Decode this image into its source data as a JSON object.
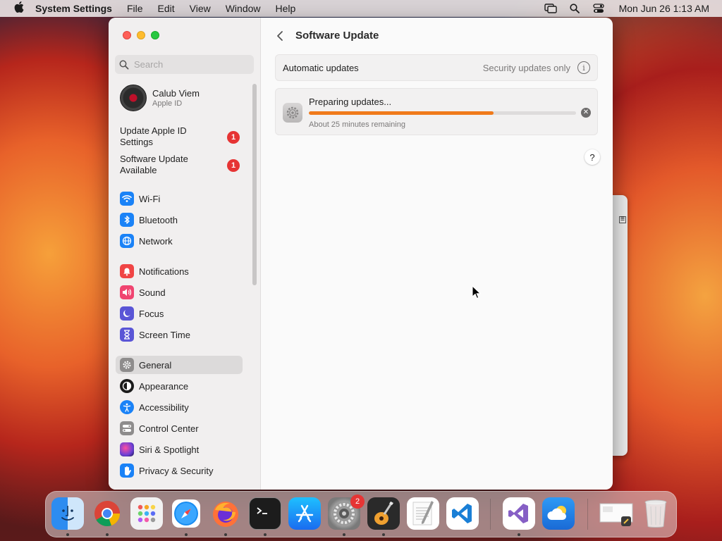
{
  "menubar": {
    "app_name": "System Settings",
    "menus": [
      "File",
      "Edit",
      "View",
      "Window",
      "Help"
    ],
    "clock": "Mon Jun 26  1:13 AM"
  },
  "sidebar": {
    "search_placeholder": "Search",
    "account": {
      "name": "Calub Viem",
      "subtitle": "Apple ID"
    },
    "notices": [
      {
        "label": "Update Apple ID Settings",
        "badge": "1"
      },
      {
        "label": "Software Update Available",
        "badge": "1"
      }
    ],
    "items": [
      {
        "label": "Wi-Fi",
        "icon": "wifi-icon",
        "color": "#1a82f7"
      },
      {
        "label": "Bluetooth",
        "icon": "bluetooth-icon",
        "color": "#1a82f7"
      },
      {
        "label": "Network",
        "icon": "globe-icon",
        "color": "#1a82f7"
      },
      {
        "label": "Notifications",
        "icon": "bell-icon",
        "color": "#f04444"
      },
      {
        "label": "Sound",
        "icon": "speaker-icon",
        "color": "#f04470"
      },
      {
        "label": "Focus",
        "icon": "moon-icon",
        "color": "#5a55d6"
      },
      {
        "label": "Screen Time",
        "icon": "hourglass-icon",
        "color": "#5a55d6"
      },
      {
        "label": "General",
        "icon": "gear-icon",
        "color": "#8e8c8c"
      },
      {
        "label": "Appearance",
        "icon": "appearance-icon",
        "color": "#1b1b1b"
      },
      {
        "label": "Accessibility",
        "icon": "accessibility-icon",
        "color": "#1a82f7"
      },
      {
        "label": "Control Center",
        "icon": "control-center-icon",
        "color": "#8e8c8c"
      },
      {
        "label": "Siri & Spotlight",
        "icon": "siri-icon",
        "color": "#6b3fd6"
      },
      {
        "label": "Privacy & Security",
        "icon": "hand-icon",
        "color": "#1a82f7"
      }
    ],
    "selected": "General"
  },
  "content": {
    "title": "Software Update",
    "automatic_updates": {
      "label": "Automatic updates",
      "value": "Security updates only"
    },
    "update": {
      "title": "Preparing updates...",
      "subtitle": "About 25 minutes remaining",
      "progress_percent": 69,
      "progress_color": "#f07a1a"
    },
    "help": "?"
  },
  "dock": {
    "system_settings_badge": "2"
  }
}
